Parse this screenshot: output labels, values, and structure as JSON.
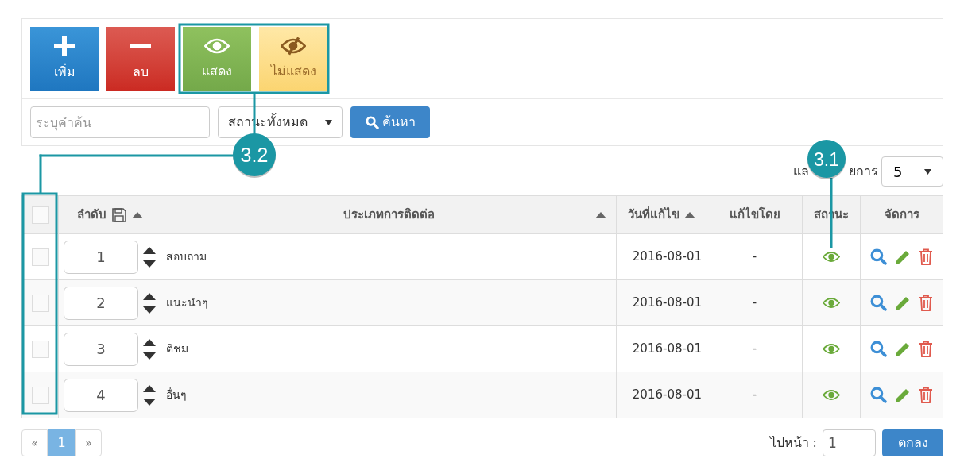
{
  "toolbar": [
    {
      "kind": "add",
      "label": "เพิ่ม"
    },
    {
      "kind": "delete",
      "label": "ลบ"
    },
    {
      "kind": "show",
      "label": "แสดง"
    },
    {
      "kind": "hide",
      "label": "ไม่แสดง"
    }
  ],
  "search": {
    "placeholder": "ระบุคำค้น",
    "status_filter": "สถานะทั้งหมด",
    "button": "ค้นหา"
  },
  "page_size": {
    "label_parts": [
      "แล",
      "ยการ"
    ],
    "value": "5"
  },
  "table": {
    "select_all": {
      "checked": false
    },
    "columns": [
      {
        "label": "ลำดับ",
        "kind": "order"
      },
      {
        "label": "ประเภทการติดต่อ",
        "kind": "sort"
      },
      {
        "label": "วันที่แก้ไข",
        "kind": "sort"
      },
      {
        "label": "แก้ไขโดย",
        "kind": "plain"
      },
      {
        "label": "สถานะ",
        "kind": "plain"
      },
      {
        "label": "จัดการ",
        "kind": "plain"
      }
    ],
    "rows": [
      {
        "checked": false,
        "order": "1",
        "type": "สอบถาม",
        "date": "2016-08-01",
        "editor": "-",
        "visible": true
      },
      {
        "checked": false,
        "order": "2",
        "type": "แนะนำๆ",
        "date": "2016-08-01",
        "editor": "-",
        "visible": true
      },
      {
        "checked": false,
        "order": "3",
        "type": "ติชม",
        "date": "2016-08-01",
        "editor": "-",
        "visible": true
      },
      {
        "checked": false,
        "order": "4",
        "type": "อื่นๆ",
        "date": "2016-08-01",
        "editor": "-",
        "visible": true
      }
    ]
  },
  "pagination": {
    "prev": "«",
    "pages": [
      {
        "label": "1",
        "selected": true
      }
    ],
    "next": "»"
  },
  "goto": {
    "label": "ไปหน้า :",
    "value": "1",
    "button": "ตกลง"
  },
  "annotations": [
    {
      "label": "3.2",
      "kind": "frame"
    },
    {
      "label": "3.1",
      "kind": "pointer"
    }
  ]
}
